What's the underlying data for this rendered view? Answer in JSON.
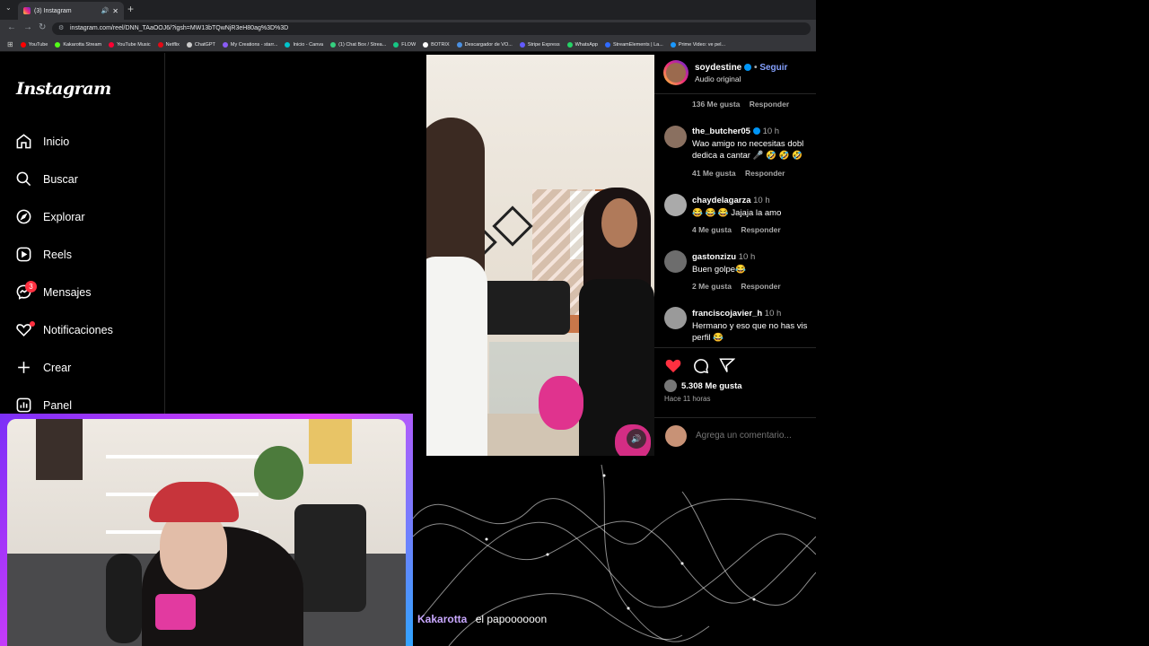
{
  "browser": {
    "tab_title": "(3) Instagram",
    "new_tab": "+",
    "url": "instagram.com/reel/DNN_TAaOOJ6/?igsh=MW13bTQwNjR3eH80ag%3D%3D",
    "bookmarks": [
      {
        "label": "YouTube",
        "color": "#ff0000"
      },
      {
        "label": "Kakarotta Stream",
        "color": "#53fc18"
      },
      {
        "label": "YouTube Music",
        "color": "#ff0033"
      },
      {
        "label": "Netflix",
        "color": "#e50914"
      },
      {
        "label": "ChatGPT",
        "color": "#cccccc"
      },
      {
        "label": "My Creations - starr...",
        "color": "#8a5cf6"
      },
      {
        "label": "Inicio - Canva",
        "color": "#00c4cc"
      },
      {
        "label": "(1) Chat Box / Strea...",
        "color": "#35d07f"
      },
      {
        "label": "FLOW",
        "color": "#16c784"
      },
      {
        "label": "BOTRIX",
        "color": "#ffffff"
      },
      {
        "label": "Descargador de VO...",
        "color": "#4a90e2"
      },
      {
        "label": "Stripe Express",
        "color": "#635bff"
      },
      {
        "label": "WhatsApp",
        "color": "#25d366"
      },
      {
        "label": "StreamElements | La...",
        "color": "#2f6bff"
      },
      {
        "label": "Prime Video: ve pel...",
        "color": "#1a98ff"
      }
    ]
  },
  "sidebar": {
    "logo": "Instagram",
    "items": [
      {
        "label": "Inicio",
        "icon": "home-icon"
      },
      {
        "label": "Buscar",
        "icon": "search-icon"
      },
      {
        "label": "Explorar",
        "icon": "compass-icon"
      },
      {
        "label": "Reels",
        "icon": "reels-icon"
      },
      {
        "label": "Mensajes",
        "icon": "messenger-icon"
      },
      {
        "label": "Notificaciones",
        "icon": "heart-icon"
      },
      {
        "label": "Crear",
        "icon": "plus-icon"
      },
      {
        "label": "Panel",
        "icon": "chart-icon"
      }
    ],
    "messages_badge": "3"
  },
  "post": {
    "author": "soydestine",
    "follow": "Seguir",
    "audio": "Audio original",
    "top_meta": {
      "likes": "136 Me gusta",
      "reply": "Responder"
    },
    "comments": [
      {
        "user": "the_butcher05",
        "verified": true,
        "time": "10 h",
        "lines": [
          "Wao amigo no necesitas dobl",
          "dedica a cantar 🎤 🤣 🤣 🤣"
        ],
        "likes": "41 Me gusta",
        "reply": "Responder"
      },
      {
        "user": "chaydelagarza",
        "verified": false,
        "time": "10 h",
        "lines": [
          "😂 😂 😂 Jajaja la amo"
        ],
        "likes": "4 Me gusta",
        "reply": "Responder"
      },
      {
        "user": "gastonzizu",
        "verified": false,
        "time": "10 h",
        "lines": [
          "Buen golpe😂"
        ],
        "likes": "2 Me gusta",
        "reply": "Responder"
      },
      {
        "user": "franciscojavier_h",
        "verified": false,
        "time": "10 h",
        "lines": [
          "Hermano y eso que no has vis",
          "perfil 😂"
        ],
        "likes": "",
        "reply": ""
      }
    ],
    "likes_total": "5.308 Me gusta",
    "posted": "Hace 11 horas",
    "comment_placeholder": "Agrega un comentario...",
    "like_color": "#ff3040"
  },
  "chat": {
    "user": "Kakarotta",
    "message": "el papoooooon"
  },
  "colors": {
    "accent_blue": "#0095f6",
    "follow_link": "#85a1ff",
    "cam_border": "#a03cf5"
  }
}
